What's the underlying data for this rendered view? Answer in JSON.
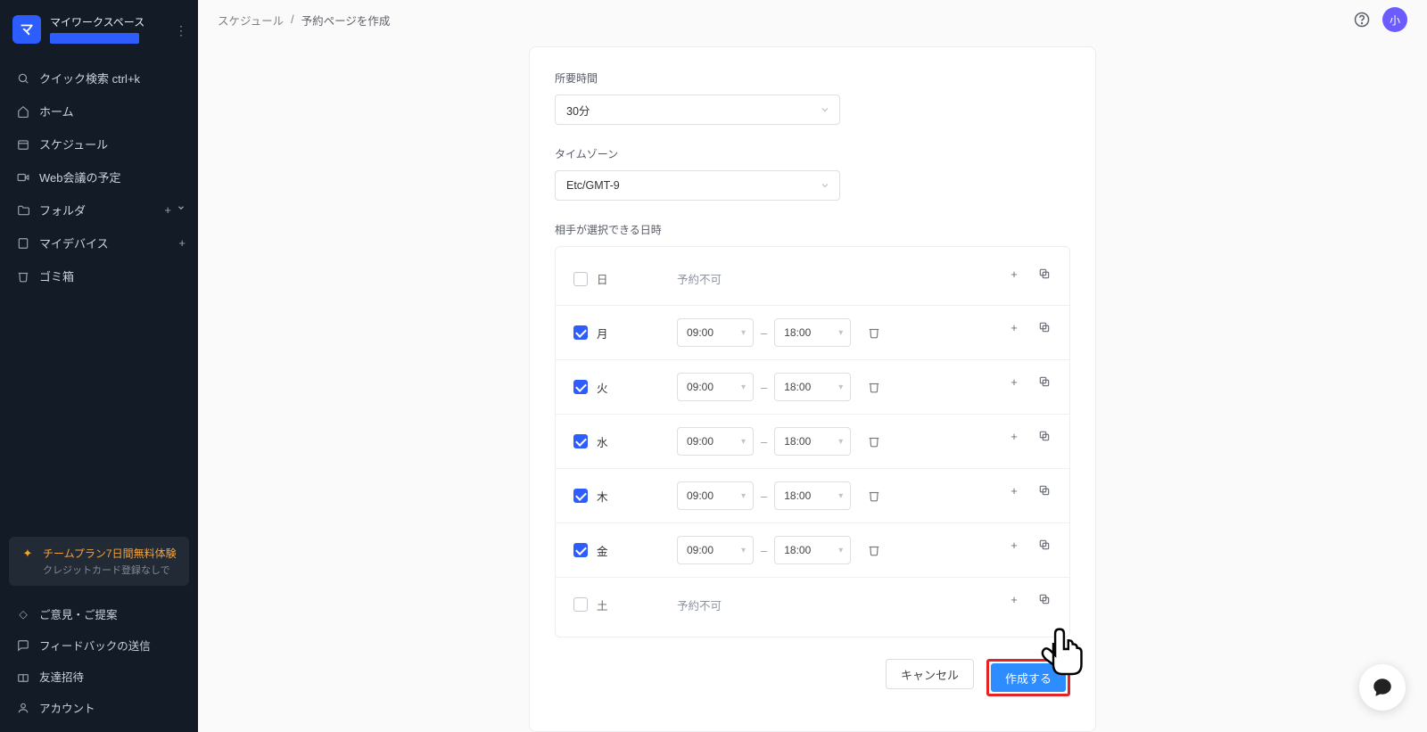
{
  "workspace": {
    "logo_char": "マ",
    "name": "マイワークスペース"
  },
  "nav": {
    "search": "クイック検索 ctrl+k",
    "home": "ホーム",
    "schedule": "スケジュール",
    "meetings": "Web会議の予定",
    "folders": "フォルダ",
    "devices": "マイデバイス",
    "trash": "ゴミ箱"
  },
  "promo": {
    "line1": "チームプラン7日間無料体験",
    "line2": "クレジットカード登録なしで"
  },
  "bottom": {
    "feedback": "ご意見・ご提案",
    "send_feedback": "フィードバックの送信",
    "invite": "友達招待",
    "account": "アカウント"
  },
  "breadcrumb": {
    "root": "スケジュール",
    "sep": "/",
    "current": "予約ページを作成"
  },
  "avatar_char": "小",
  "form": {
    "duration_label": "所要時間",
    "duration_value": "30分",
    "timezone_label": "タイムゾーン",
    "timezone_value": "Etc/GMT-9",
    "availability_label": "相手が選択できる日時"
  },
  "days": [
    {
      "label": "日",
      "enabled": false,
      "unavailable_text": "予約不可"
    },
    {
      "label": "月",
      "enabled": true,
      "start": "09:00",
      "end": "18:00"
    },
    {
      "label": "火",
      "enabled": true,
      "start": "09:00",
      "end": "18:00"
    },
    {
      "label": "水",
      "enabled": true,
      "start": "09:00",
      "end": "18:00"
    },
    {
      "label": "木",
      "enabled": true,
      "start": "09:00",
      "end": "18:00"
    },
    {
      "label": "金",
      "enabled": true,
      "start": "09:00",
      "end": "18:00"
    },
    {
      "label": "土",
      "enabled": false,
      "unavailable_text": "予約不可"
    }
  ],
  "actions": {
    "cancel": "キャンセル",
    "create": "作成する"
  },
  "dash": "–"
}
